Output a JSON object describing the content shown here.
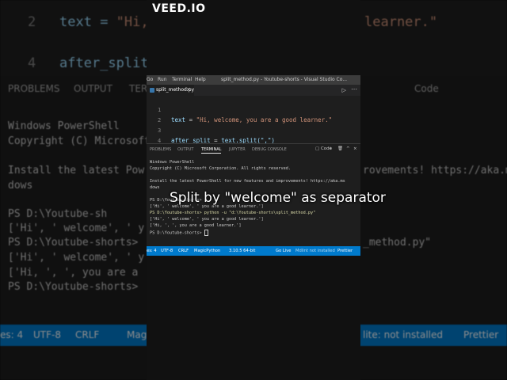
{
  "watermark": "VEED.IO",
  "caption": "Split by \"welcome\" as separator",
  "window": {
    "menus": [
      "Go",
      "Run",
      "Terminal",
      "Help"
    ],
    "title": "split_method.py - Youtube-shorts - Visual Studio Co...",
    "tab_label": "split_method.py",
    "tab_close": "×"
  },
  "editor": {
    "lines": [
      {
        "num": "1",
        "var": "",
        "op": "",
        "str": ""
      },
      {
        "num": "2",
        "var": "text",
        "op": " = ",
        "str": "\"Hi, welcome, you are a good learner.\""
      },
      {
        "num": "3",
        "var": "",
        "op": "",
        "str": ""
      },
      {
        "num": "4",
        "var": "after_split",
        "op": " = ",
        "call": "text.split(\",\")"
      }
    ]
  },
  "panel": {
    "tabs": [
      "PROBLEMS",
      "OUTPUT",
      "TERMINAL",
      "JUPYTER",
      "DEBUG CONSOLE"
    ],
    "active_tab": "TERMINAL",
    "shell_label": "Code",
    "lines": [
      "Windows PowerShell",
      "Copyright (C) Microsoft Corporation. All rights reserved.",
      "",
      "Install the latest PowerShell for new features and improvements! https://aka.ms",
      "dows",
      "",
      "PS D:\\Youtube-shorts>",
      "['Hi', ' welcome', ' you are a good learner.']",
      "PS D:\\Youtube-shorts> python -u \"d:\\Youtube-shorts\\split_method.py\"",
      "['Hi', ' welcome', ' you are a good learner.']",
      "['Hi, ', ', you are a good learner.']",
      "PS D:\\Youtube-shorts> "
    ]
  },
  "statusbar": {
    "items": [
      "es: 4",
      "UTF-8",
      "CRLF",
      "MagicPython",
      "3.10.5 64-bit",
      "Go Live",
      "Mdlint not installed",
      "Prettier"
    ]
  },
  "background": {
    "code_lines": [
      {
        "num": "2",
        "var": "text",
        "op": " = ",
        "str": "\"Hi,"
      },
      {
        "num": "4",
        "var": "after_split",
        "op": "",
        "str": ""
      }
    ],
    "code_tail": "learner.\"",
    "tabs": [
      "PROBLEMS",
      "OUTPUT",
      "TER",
      "Code"
    ],
    "term_lines": [
      "Windows PowerShell",
      "Copyright (C) Microsoft",
      "",
      "Install the latest Pow",
      "dows",
      "",
      "PS D:\\Youtube-sh",
      "['Hi', ' welcome', ' y",
      "PS D:\\Youtube-shorts>",
      "['Hi', ' welcome', ' y",
      "['Hi, ', ', you are a",
      "PS D:\\Youtube-shorts>"
    ],
    "right_fragments": [
      "rovements! https://aka.ms",
      "_method.py\""
    ],
    "status": [
      "es: 4",
      "UTF-8",
      "CRLF",
      "Magic",
      "lite: not installed",
      "Prettier"
    ]
  }
}
